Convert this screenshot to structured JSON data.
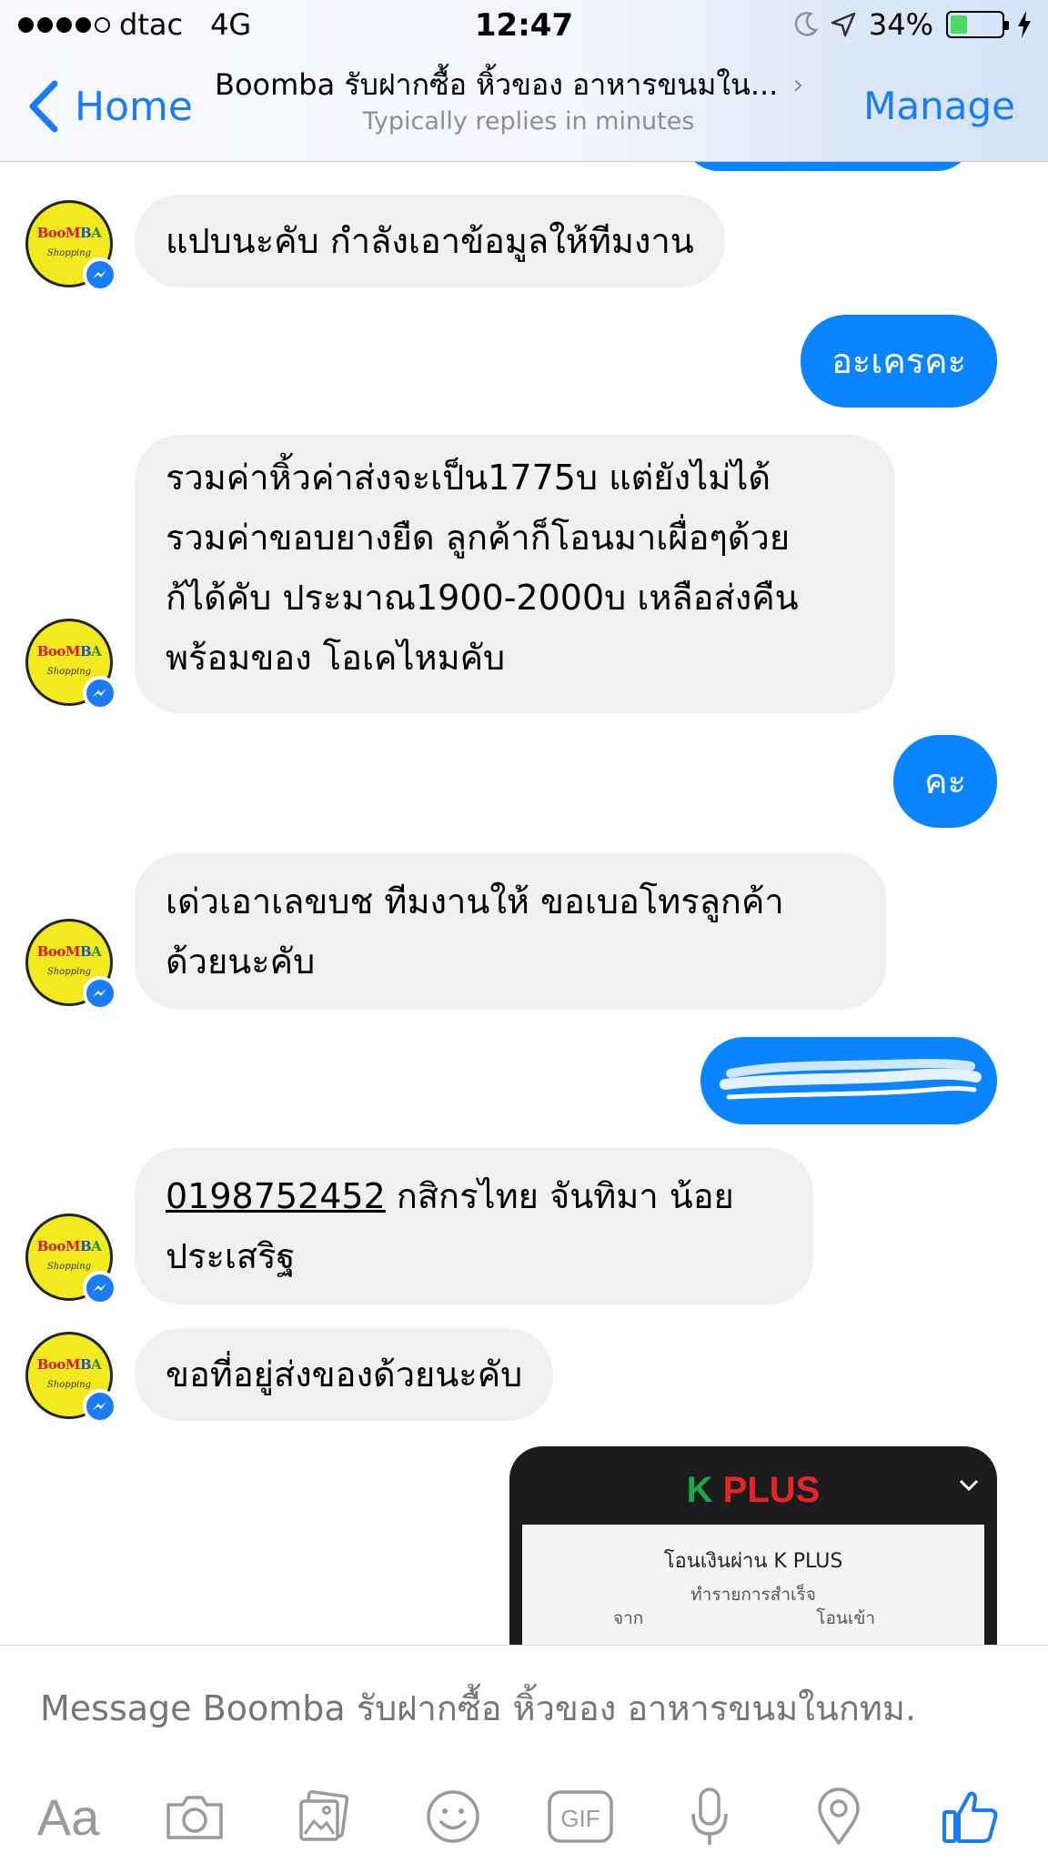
{
  "status_bar": {
    "carrier": "dtac",
    "network": "4G",
    "time": "12:47",
    "battery_percent": "34%",
    "battery_level": 0.34
  },
  "nav": {
    "back_label": "Home",
    "title": "Boomba รับฝากซื้อ หิ้วของ อาหารขนมใน...",
    "subtitle": "Typically replies in minutes",
    "manage_label": "Manage"
  },
  "avatar": {
    "logo_boo": "BooM",
    "logo_b": "B",
    "logo_a": "A",
    "logo_sub": "Shopping"
  },
  "messages": {
    "m1": "แปบนะคับ กำลังเอาข้อมูลให้ทีมงาน",
    "m2": "อะเครคะ",
    "m3": [
      "รวมค่าหิ้วค่าส่งจะเป็น1775บ แต่ยังไม่ได้",
      "รวมค่าขอบยางยืด ลูกค้าก็โอนมาเผื่อๆด้วย",
      "ก้ได้คับ ประมาณ1900-2000บ เหลือส่งคืน",
      "พร้อมของ โอเคไหมคับ"
    ],
    "m4": "คะ",
    "m5": [
      "เด่วเอาเลขบช ทีมงานให้  ขอเบอโทรลูกค้า",
      "ด้วยนะคับ"
    ],
    "m7": {
      "account": "0198752452",
      "line1_rest": " กสิกรไทย จันทิมา น้อย",
      "line2": "ประเสริฐ"
    },
    "m8": "ขอที่อยู่ส่งของด้วยนะคับ"
  },
  "shared_image": {
    "logo_k": "K",
    "logo_plus": " PLUS",
    "card_title": "โอนเงินผ่าน K PLUS",
    "card_status": "ทำรายการสำเร็จ",
    "from_label": "จาก",
    "to_label": "โอนเข้า"
  },
  "composer": {
    "placeholder": "Message Boomba รับฝากซื้อ หิ้วของ อาหารขนมในกทม.",
    "aa_label": "Aa"
  },
  "colors": {
    "accent": "#1a7cf5",
    "outgoing_bubble": "#0a84ff",
    "incoming_bubble": "#f1f0f0",
    "avatar_yellow": "#f2ea1e"
  }
}
